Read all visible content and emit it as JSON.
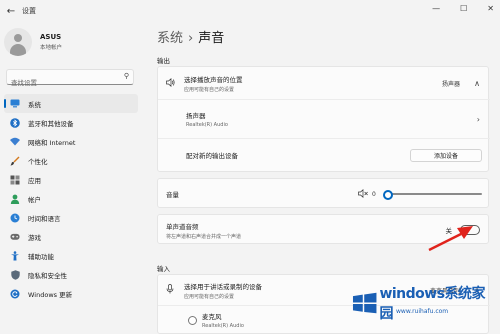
{
  "window": {
    "title": "设置",
    "controls": {
      "minimize": "—",
      "maximize": "☐",
      "close": "✕"
    }
  },
  "profile": {
    "name": "ASUS",
    "subtitle": "本地帐户"
  },
  "search": {
    "placeholder": "查找设置"
  },
  "nav": [
    {
      "label": "系统",
      "icon": "monitor-icon",
      "active": true
    },
    {
      "label": "蓝牙和其他设备",
      "icon": "bluetooth-icon"
    },
    {
      "label": "网络和 Internet",
      "icon": "wifi-icon"
    },
    {
      "label": "个性化",
      "icon": "brush-icon"
    },
    {
      "label": "应用",
      "icon": "apps-icon"
    },
    {
      "label": "帐户",
      "icon": "person-icon"
    },
    {
      "label": "时间和语言",
      "icon": "globe-clock-icon"
    },
    {
      "label": "游戏",
      "icon": "gamepad-icon"
    },
    {
      "label": "辅助功能",
      "icon": "accessibility-icon"
    },
    {
      "label": "隐私和安全性",
      "icon": "shield-icon"
    },
    {
      "label": "Windows 更新",
      "icon": "update-icon"
    }
  ],
  "breadcrumb": {
    "parent": "系统",
    "separator": "›",
    "current": "声音"
  },
  "output": {
    "section_label": "输出",
    "choose_output": {
      "title": "选择播放声音的位置",
      "subtitle": "应用可能有自己的设置",
      "value": "扬声器"
    },
    "speaker": {
      "name": "扬声器",
      "driver": "Realtek(R) Audio"
    },
    "pair": {
      "label": "配对新的输出设备",
      "button": "添加设备"
    },
    "volume": {
      "label": "音量",
      "value": "0",
      "level": 0
    },
    "mono": {
      "title": "单声道音频",
      "subtitle": "将左声道和右声道合并成一个声道",
      "state_label": "关",
      "on": false
    }
  },
  "input": {
    "section_label": "输入",
    "choose_input": {
      "title": "选择用于讲话或录制的设备",
      "subtitle": "应用可能有自己的设置",
      "value": "麦克风阵列"
    },
    "mic": {
      "name": "麦克风",
      "driver": "Realtek(R) Audio"
    }
  },
  "watermark": {
    "brand": "windows系统家园",
    "url": "www.ruihafu.com"
  },
  "colors": {
    "accent": "#0067c0",
    "arrow": "#e0231c",
    "watermark": "#1a5fb4"
  }
}
